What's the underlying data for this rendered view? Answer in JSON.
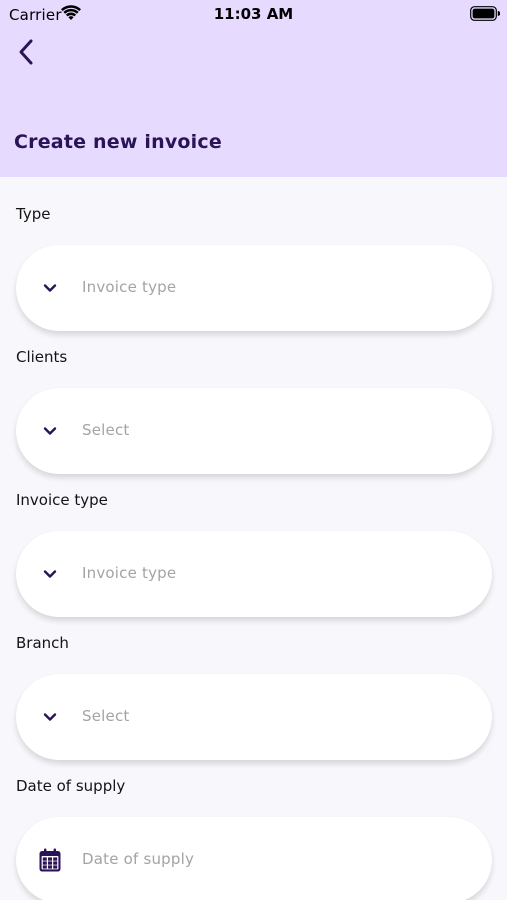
{
  "status_bar": {
    "carrier": "Carrier",
    "time": "11:03 AM"
  },
  "header": {
    "title": "Create new invoice",
    "back_icon": "chevron-left-icon",
    "background": "#e6daff",
    "title_color": "#2a1356"
  },
  "form": {
    "fields": [
      {
        "label": "Type",
        "placeholder": "Invoice type",
        "icon": "chevron-down-icon"
      },
      {
        "label": "Clients",
        "placeholder": "Select",
        "icon": "chevron-down-icon"
      },
      {
        "label": "Invoice type",
        "placeholder": "Invoice type",
        "icon": "chevron-down-icon"
      },
      {
        "label": "Branch",
        "placeholder": "Select",
        "icon": "chevron-down-icon"
      },
      {
        "label": "Date of supply",
        "placeholder": "Date of supply",
        "icon": "calendar-icon"
      }
    ]
  },
  "colors": {
    "accent": "#2a1356",
    "placeholder": "#a3a3a8",
    "page_background": "#f8f8fc"
  }
}
